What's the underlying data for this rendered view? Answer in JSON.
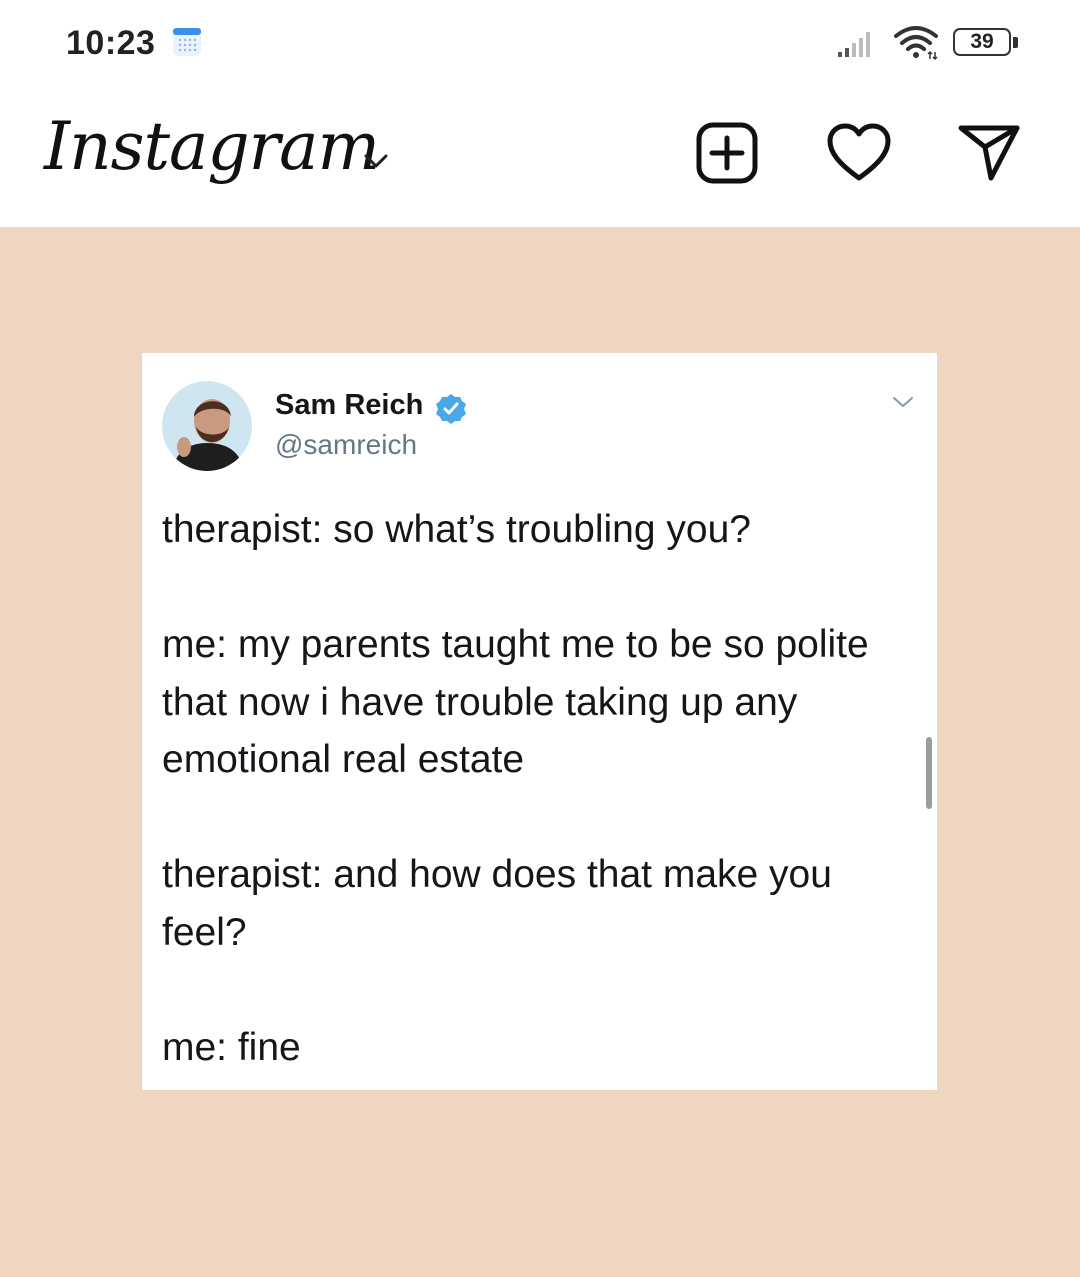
{
  "status_bar": {
    "time": "10:23",
    "calendar_icon": "calendar-icon",
    "signal_icon": "signal-icon",
    "wifi_icon": "wifi-icon",
    "battery_percent": "39"
  },
  "header": {
    "logo_text": "Instagram",
    "icons": [
      "chevron-down-icon",
      "add-post-icon",
      "heart-icon",
      "send-icon"
    ]
  },
  "post": {
    "background_color": "#efd6c1",
    "tweet": {
      "author_name": "Sam Reich",
      "handle": "@samreich",
      "lines": [
        "therapist: so what’s troubling you?",
        "me: my parents taught me to be so polite that now i have trouble taking up any emotional real estate",
        "therapist: and how does that make you feel?",
        "me: fine"
      ]
    }
  },
  "colors": {
    "verified_blue": "#4aa8e6",
    "handle_gray": "#657786",
    "calendar_blue": "#3b8fe8"
  }
}
